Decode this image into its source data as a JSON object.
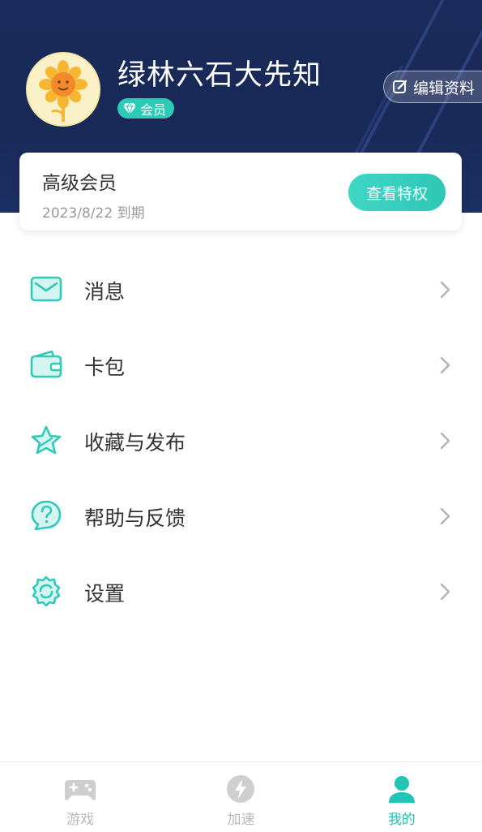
{
  "profile": {
    "username": "绿林六石大先知",
    "badge_label": "会员",
    "edit_label": "编辑资料",
    "avatar_icon": "sunflower-avatar"
  },
  "membership": {
    "title": "高级会员",
    "expire": "2023/8/22 到期",
    "button_label": "查看特权"
  },
  "menu": {
    "items": [
      {
        "label": "消息",
        "icon": "envelope-icon"
      },
      {
        "label": "卡包",
        "icon": "wallet-icon"
      },
      {
        "label": "收藏与发布",
        "icon": "star-icon"
      },
      {
        "label": "帮助与反馈",
        "icon": "help-icon"
      },
      {
        "label": "设置",
        "icon": "gear-icon"
      }
    ]
  },
  "tabbar": {
    "tabs": [
      {
        "label": "游戏",
        "icon": "gamepad-icon",
        "active": false
      },
      {
        "label": "加速",
        "icon": "lightning-icon",
        "active": false
      },
      {
        "label": "我的",
        "icon": "person-icon",
        "active": true
      }
    ]
  },
  "colors": {
    "header_bg": "#1a2a5a",
    "accent": "#2ccab7",
    "inactive": "#b8b8b8"
  }
}
